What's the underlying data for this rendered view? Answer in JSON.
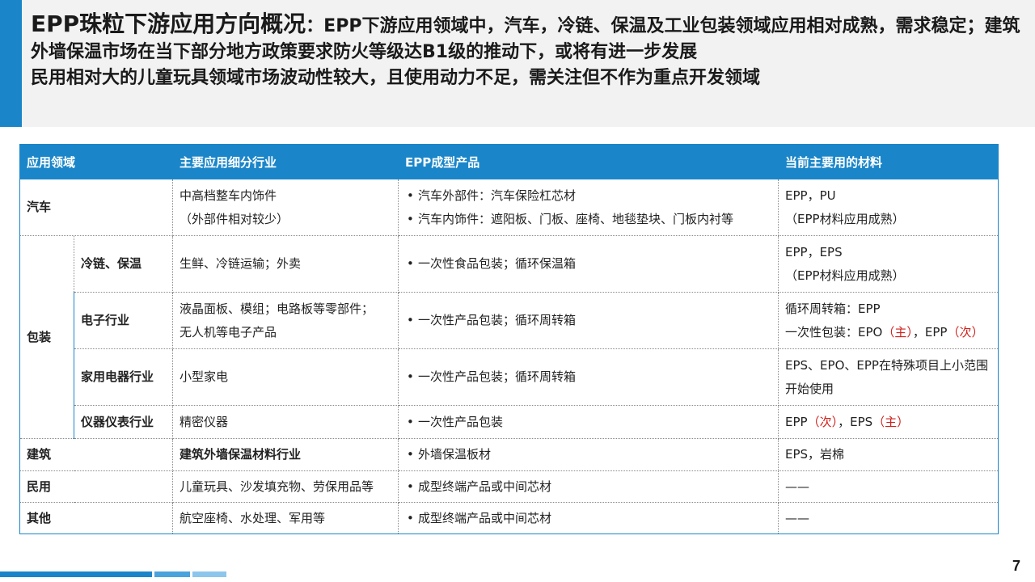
{
  "header": {
    "title": "EPP珠粒下游应用方向概况",
    "line1": "：EPP下游应用领域中，汽车，冷链、保温及工业包装领域应用相对成熟，需求稳定；建筑外墙保温市场在当下部分地方政策要求防火等级达B1级的推动下，或将有进一步发展",
    "line2": "民用相对大的儿童玩具领域市场波动性较大，且使用动力不足，需关注但不作为重点开发领域"
  },
  "table": {
    "headers": [
      "应用领域",
      "主要应用细分行业",
      "EPP成型产品",
      "当前主要用的材料"
    ],
    "auto": {
      "field": "汽车",
      "industry_1": "中高档整车内饰件",
      "industry_2": "（外部件相对较少）",
      "product_1": "汽车外部件：汽车保险杠芯材",
      "product_2": "汽车内饰件：遮阳板、门板、座椅、地毯垫块、门板内衬等",
      "material_1": "EPP，PU",
      "material_2": "（EPP材料应用成熟）"
    },
    "packaging": {
      "field": "包装",
      "cold": {
        "sub": "冷链、保温",
        "industry": "生鲜、冷链运输；外卖",
        "product": "一次性食品包装；循环保温箱",
        "material_1": "EPP，EPS",
        "material_2": "（EPP材料应用成熟）"
      },
      "electronic": {
        "sub": "电子行业",
        "industry_1": "液晶面板、模组；电路板等零部件；",
        "industry_2": "无人机等电子产品",
        "product": "一次性产品包装；循环周转箱",
        "material_1": "循环周转箱：EPP",
        "material_2a": "一次性包装：EPO",
        "material_2b": "（主）",
        "material_2c": "，EPP",
        "material_2d": "（次）"
      },
      "appliance": {
        "sub": "家用电器行业",
        "industry": "小型家电",
        "product": "一次性产品包装；循环周转箱",
        "material": "EPS、EPO、EPP在特殊项目上小范围开始使用"
      },
      "instrument": {
        "sub": "仪器仪表行业",
        "industry": "精密仪器",
        "product": "一次性产品包装",
        "material_a": "EPP",
        "material_b": "（次）",
        "material_c": "，EPS",
        "material_d": "（主）"
      }
    },
    "construction": {
      "field": "建筑",
      "industry": "建筑外墙保温材料行业",
      "product": "外墙保温板材",
      "material": "EPS，岩棉"
    },
    "civil": {
      "field": "民用",
      "industry": "儿童玩具、沙发填充物、劳保用品等",
      "product": "成型终端产品或中间芯材",
      "material": "——"
    },
    "other": {
      "field": "其他",
      "industry": "航空座椅、水处理、军用等",
      "product": "成型终端产品或中间芯材",
      "material": "——"
    }
  },
  "page_number": "7",
  "colors": {
    "accent": "#1a86c9",
    "highlight": "#d0201c",
    "header_bg": "#f2f2f2"
  }
}
